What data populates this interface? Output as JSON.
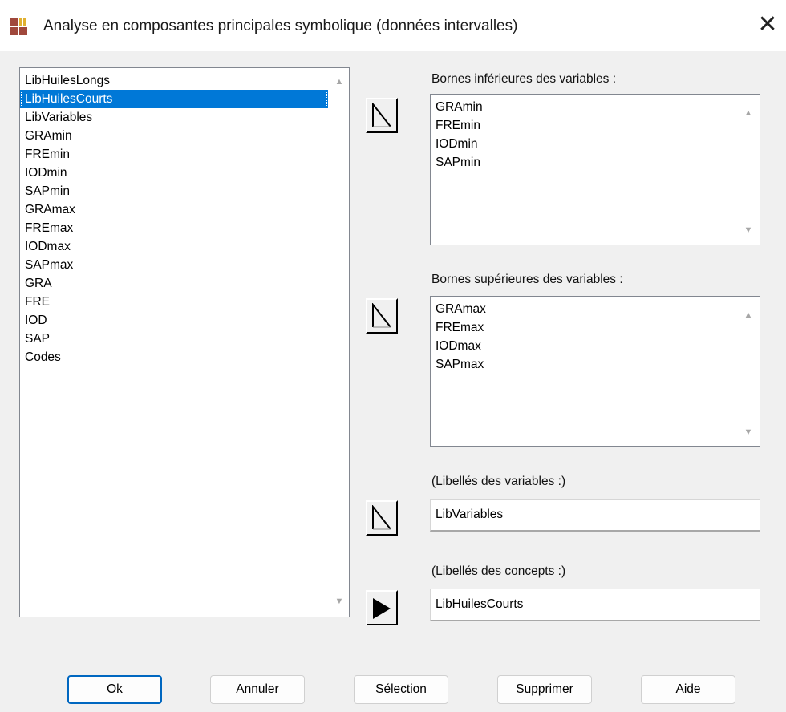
{
  "window": {
    "title": "Analyse en composantes principales symbolique (données intervalles)",
    "close_glyph": "✕",
    "icon": "app-grid-icon"
  },
  "source_list": {
    "items": [
      "LibHuilesLongs",
      "LibHuilesCourts",
      "LibVariables",
      "GRAmin",
      "FREmin",
      "IODmin",
      "SAPmin",
      "GRAmax",
      "FREmax",
      "IODmax",
      "SAPmax",
      "GRA",
      "FRE",
      "IOD",
      "SAP",
      "Codes"
    ],
    "selected": "LibHuilesCourts"
  },
  "lower_bounds": {
    "label": "Bornes inférieures des variables :",
    "items": [
      "GRAmin",
      "FREmin",
      "IODmin",
      "SAPmin"
    ]
  },
  "upper_bounds": {
    "label": "Bornes supérieures des variables :",
    "items": [
      "GRAmax",
      "FREmax",
      "IODmax",
      "SAPmax"
    ]
  },
  "var_labels": {
    "label": "(Libellés des variables :)",
    "value": "LibVariables"
  },
  "concept_labels": {
    "label": "(Libellés des concepts :)",
    "value": "LibHuilesCourts"
  },
  "buttons": {
    "ok": "Ok",
    "cancel": "Annuler",
    "selection": "Sélection",
    "delete": "Supprimer",
    "help": "Aide"
  },
  "scroll_up_glyph": "▲",
  "scroll_down_glyph": "▼",
  "colors": {
    "selection": "#0078d7",
    "accent": "#0067c0"
  }
}
